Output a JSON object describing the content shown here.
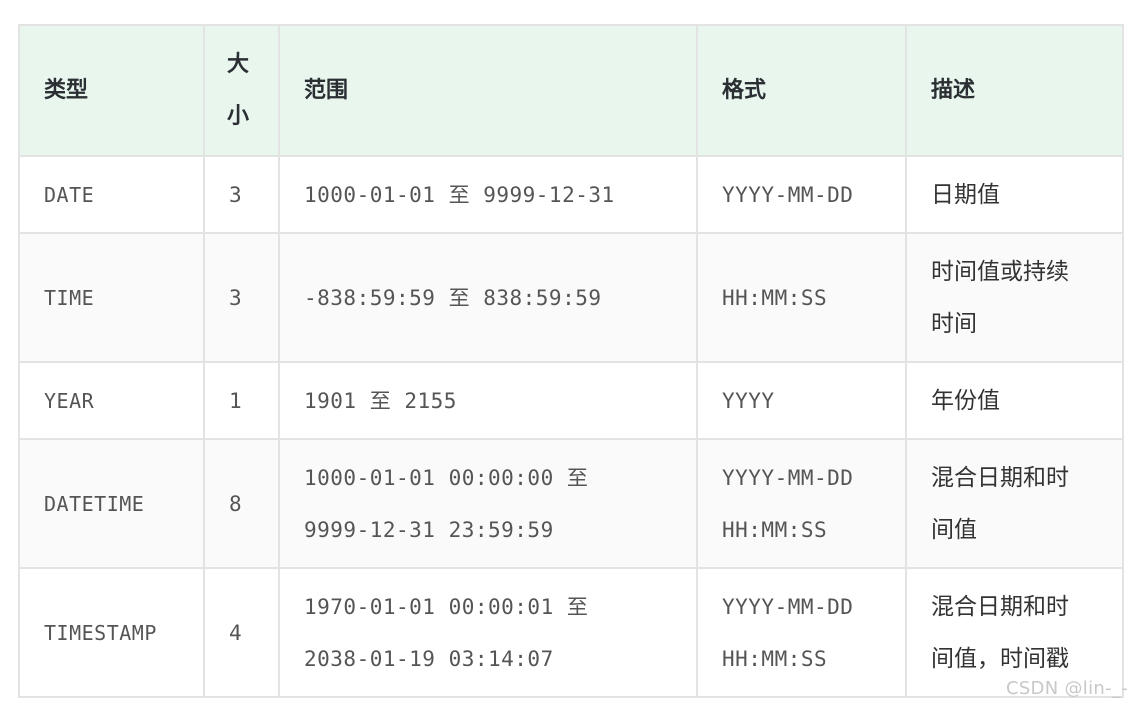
{
  "table": {
    "headers": {
      "type": "类型",
      "size_line1": "大",
      "size_line2": "小",
      "range": "范围",
      "format": "格式",
      "desc": "描述"
    },
    "rows": [
      {
        "type": "DATE",
        "size": "3",
        "range": [
          "1000-01-01 至 9999-12-31"
        ],
        "format": [
          "YYYY-MM-DD"
        ],
        "desc": [
          "日期值"
        ]
      },
      {
        "type": "TIME",
        "size": "3",
        "range": [
          "-838:59:59 至 838:59:59"
        ],
        "format": [
          "HH:MM:SS"
        ],
        "desc": [
          "时间值或持续",
          "时间"
        ]
      },
      {
        "type": "YEAR",
        "size": "1",
        "range": [
          "1901 至 2155"
        ],
        "format": [
          "YYYY"
        ],
        "desc": [
          "年份值"
        ]
      },
      {
        "type": "DATETIME",
        "size": "8",
        "range": [
          "1000-01-01 00:00:00 至",
          "9999-12-31 23:59:59"
        ],
        "format": [
          "YYYY-MM-DD",
          "HH:MM:SS"
        ],
        "desc": [
          "混合日期和时",
          "间值"
        ]
      },
      {
        "type": "TIMESTAMP",
        "size": "4",
        "range": [
          "1970-01-01 00:00:01 至",
          "2038-01-19 03:14:07"
        ],
        "format": [
          "YYYY-MM-DD",
          "HH:MM:SS"
        ],
        "desc": [
          "混合日期和时",
          "间值，时间戳"
        ]
      }
    ]
  },
  "watermark": "CSDN @lin-_-"
}
